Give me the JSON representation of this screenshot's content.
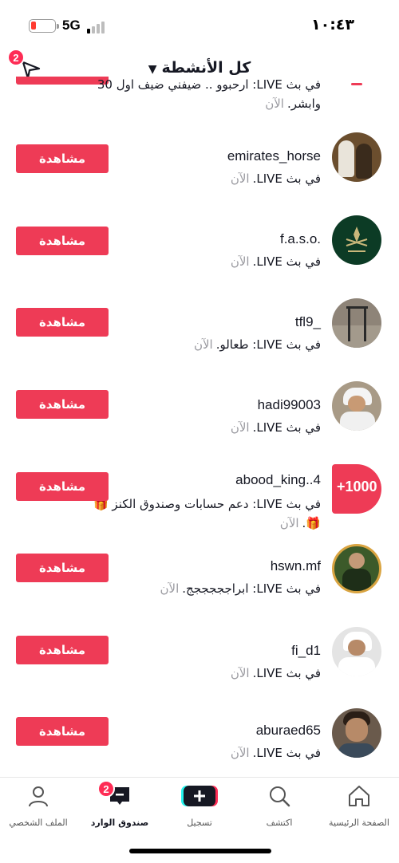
{
  "status_bar": {
    "network": "5G",
    "time": "١٠:٤٣"
  },
  "header": {
    "title": "كل الأنشطة",
    "notification_count": "2",
    "dropdown_icon": "chevron-down-icon",
    "send_icon": "paper-plane-icon"
  },
  "watch_label": "مشاهدة",
  "rows": [
    {
      "username": "",
      "activity": "في بث LIVE: ارحبوو .. ضيفني ضيف اول 30 وابشر.",
      "time": "الآن",
      "avatar_bg": "#ffffff"
    },
    {
      "username": "emirates_horse",
      "activity": "في بث LIVE.",
      "time": "الآن",
      "avatar_bg": "#6b4e2e"
    },
    {
      "username": "f.a.s.o.",
      "activity": "في بث LIVE.",
      "time": "الآن",
      "avatar_bg": "#0c3b25"
    },
    {
      "username": "tfl9_",
      "activity": "في بث LIVE: طعالو.",
      "time": "الآن",
      "avatar_bg": "#8e8478"
    },
    {
      "username": "hadi99003",
      "activity": "في بث LIVE.",
      "time": "الآن",
      "avatar_bg": "#a89a86"
    },
    {
      "username": "abood_king..4",
      "activity": "في بث LIVE: دعم حسابات وصندوق الكنز 🎁🎁.",
      "time": "الآن",
      "avatar_bg": "#ee3b56",
      "avatar_text": "+1000"
    },
    {
      "username": "hswn.mf",
      "activity": "في بث LIVE: ابراجججججج.",
      "time": "الآن",
      "avatar_bg": "#3c5a2a"
    },
    {
      "username": "fi_d1",
      "activity": "في بث LIVE.",
      "time": "الآن",
      "avatar_bg": "#d9d9d9"
    },
    {
      "username": "aburaed65",
      "activity": "في بث LIVE.",
      "time": "الآن",
      "avatar_bg": "#6a5a4c"
    }
  ],
  "bottom_nav": {
    "home": "الصفحة الرئيسية",
    "discover": "اكتشف",
    "record": "تسجيل",
    "inbox": "صندوق الوارد",
    "inbox_count": "2",
    "profile": "الملف الشخصي"
  },
  "colors": {
    "accent": "#ee3b56",
    "badge": "#fe2c55"
  }
}
